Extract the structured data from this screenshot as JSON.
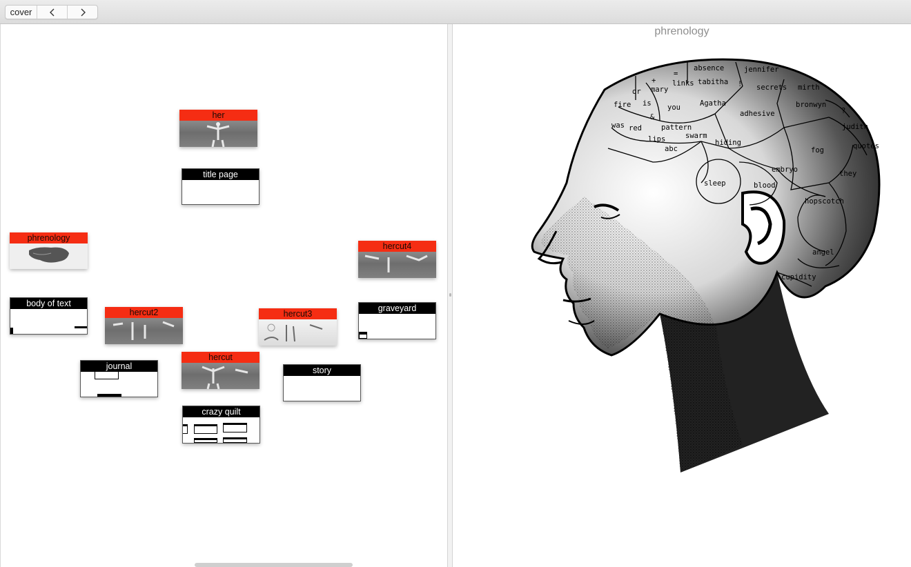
{
  "toolbar": {
    "cover_label": "cover",
    "back_icon": "chevron-left-icon",
    "forward_icon": "chevron-right-icon"
  },
  "cards": {
    "her": "her",
    "title_page": "title page",
    "phrenology": "phrenology",
    "hercut4": "hercut4",
    "body_of_text": "body of text",
    "hercut2": "hercut2",
    "hercut3": "hercut3",
    "graveyard": "graveyard",
    "journal": "journal",
    "hercut": "hercut",
    "story": "story",
    "crazy_quilt": "crazy quilt"
  },
  "colors": {
    "image_card_header": "#f52d13",
    "text_card_header": "#000000"
  },
  "document": {
    "title": "phrenology"
  },
  "phrenology_labels": {
    "absence": "absence",
    "jennifer": "jennifer",
    "plus": "+",
    "equals": "=",
    "links": "links",
    "tabitha": "tabitha",
    "bang": "!",
    "secrets": "secrets",
    "mirth": "mirth",
    "or": "or",
    "mary": "mary",
    "fire": "fire",
    "is": "is",
    "you": "you",
    "agatha": "Agatha",
    "adhesive": "adhesive",
    "bronwyn": "bronwyn",
    "question": "?",
    "ampersand": "&",
    "was": "was",
    "red": "red",
    "pattern": "pattern",
    "judith": "judith",
    "swarm": "swarm",
    "lips": "lips",
    "hiding": "hiding",
    "quotes": "quotes",
    "abc": "abc",
    "fog": "fog",
    "embryo": "embryo",
    "they": "they",
    "sleep": "sleep",
    "blood": "blood",
    "hopscotch": "hopscotch",
    "angel": "angel",
    "cupidity": "cupidity"
  }
}
